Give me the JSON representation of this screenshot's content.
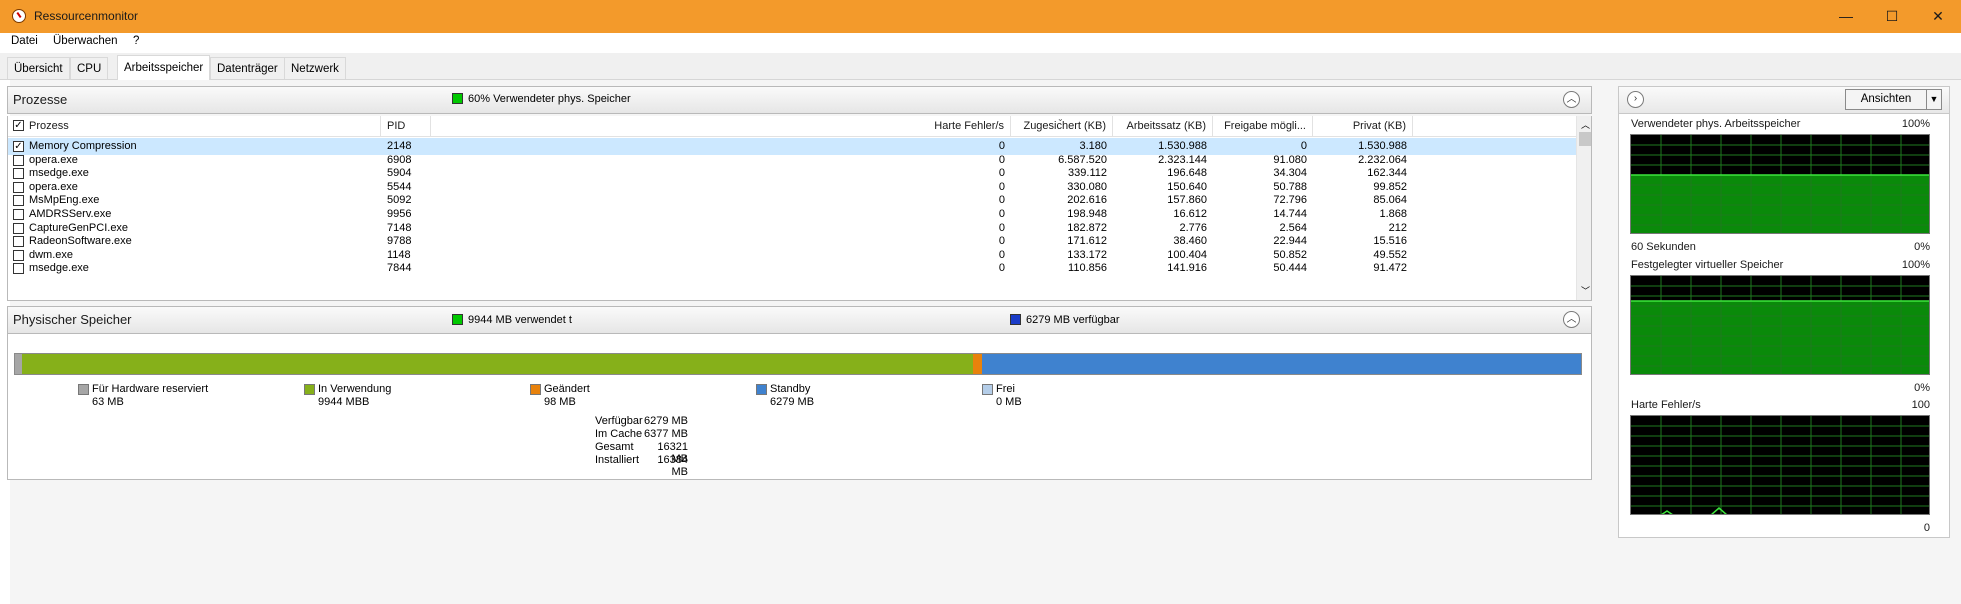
{
  "window": {
    "title": "Ressourcenmonitor",
    "controls": {
      "minimize": "—",
      "maximize": "☐",
      "close": "✕"
    }
  },
  "menu": [
    "Datei",
    "Überwachen",
    "?"
  ],
  "tabs": [
    {
      "label": "Übersicht",
      "active": false
    },
    {
      "label": "CPU",
      "active": false
    },
    {
      "label": "Arbeitsspeicher",
      "active": true
    },
    {
      "label": "Datenträger",
      "active": false
    },
    {
      "label": "Netzwerk",
      "active": false
    }
  ],
  "processes": {
    "title": "Prozesse",
    "summary": "60% Verwendeter phys. Speicher",
    "summary_color": "#00c800",
    "columns": [
      "Prozess",
      "PID",
      "Harte Fehler/s",
      "Zugesichert (KB)",
      "Arbeitssatz (KB)",
      "Freigabe mögli...",
      "Privat (KB)"
    ],
    "rows": [
      {
        "name": "Memory Compression",
        "pid": "2148",
        "faults": "0",
        "commit": "3.180",
        "working": "1.530.988",
        "shareable": "0",
        "private": "1.530.988",
        "checked": true,
        "selected": true
      },
      {
        "name": "opera.exe",
        "pid": "6908",
        "faults": "0",
        "commit": "6.587.520",
        "working": "2.323.144",
        "shareable": "91.080",
        "private": "2.232.064",
        "checked": false,
        "selected": false
      },
      {
        "name": "msedge.exe",
        "pid": "5904",
        "faults": "0",
        "commit": "339.112",
        "working": "196.648",
        "shareable": "34.304",
        "private": "162.344",
        "checked": false,
        "selected": false
      },
      {
        "name": "opera.exe",
        "pid": "5544",
        "faults": "0",
        "commit": "330.080",
        "working": "150.640",
        "shareable": "50.788",
        "private": "99.852",
        "checked": false,
        "selected": false
      },
      {
        "name": "MsMpEng.exe",
        "pid": "5092",
        "faults": "0",
        "commit": "202.616",
        "working": "157.860",
        "shareable": "72.796",
        "private": "85.064",
        "checked": false,
        "selected": false
      },
      {
        "name": "AMDRSServ.exe",
        "pid": "9956",
        "faults": "0",
        "commit": "198.948",
        "working": "16.612",
        "shareable": "14.744",
        "private": "1.868",
        "checked": false,
        "selected": false
      },
      {
        "name": "CaptureGenPCI.exe",
        "pid": "7148",
        "faults": "0",
        "commit": "182.872",
        "working": "2.776",
        "shareable": "2.564",
        "private": "212",
        "checked": false,
        "selected": false
      },
      {
        "name": "RadeonSoftware.exe",
        "pid": "9788",
        "faults": "0",
        "commit": "171.612",
        "working": "38.460",
        "shareable": "22.944",
        "private": "15.516",
        "checked": false,
        "selected": false
      },
      {
        "name": "dwm.exe",
        "pid": "1148",
        "faults": "0",
        "commit": "133.172",
        "working": "100.404",
        "shareable": "50.852",
        "private": "49.552",
        "checked": false,
        "selected": false
      },
      {
        "name": "msedge.exe",
        "pid": "7844",
        "faults": "0",
        "commit": "110.856",
        "working": "141.916",
        "shareable": "50.444",
        "private": "91.472",
        "checked": false,
        "selected": false
      }
    ]
  },
  "physical": {
    "title": "Physischer Speicher",
    "used_summary": "9944 MB verwendet t",
    "avail_summary": "6279 MB verfügbar",
    "used_color": "#00c800",
    "avail_color": "#1a3cc8",
    "bar": [
      {
        "key": "hardware",
        "mb": 63,
        "color": "#a6a6a6"
      },
      {
        "key": "inuse",
        "mb": 9944,
        "color": "#86b01a"
      },
      {
        "key": "modified",
        "mb": 98,
        "color": "#e8820c"
      },
      {
        "key": "standby",
        "mb": 6279,
        "color": "#3f82cf"
      },
      {
        "key": "free",
        "mb": 0,
        "color": "#b4cde8"
      }
    ],
    "legend": [
      {
        "label": "Für Hardware reserviert",
        "value": "63 MB",
        "color": "#a6a6a6"
      },
      {
        "label": "In Verwendung",
        "value": "9944 MBB",
        "color": "#86b01a"
      },
      {
        "label": "Geändert",
        "value": "98 MB",
        "color": "#e8820c"
      },
      {
        "label": "Standby",
        "value": "6279 MB",
        "color": "#3f82cf"
      },
      {
        "label": "Frei",
        "value": "0 MB",
        "color": "#b4cde8"
      }
    ],
    "stats": [
      {
        "label": "Verfügbar",
        "value": "6279 MB"
      },
      {
        "label": "Im Cache",
        "value": "6377 MB"
      },
      {
        "label": "Gesamt",
        "value": "16321 MB"
      },
      {
        "label": "Installiert",
        "value": "16384 MB"
      }
    ]
  },
  "graphs": {
    "views_label": "Ansichten",
    "items": [
      {
        "title": "Verwendeter phys. Arbeitsspeicher",
        "max": "100%",
        "footer_left": "60 Sekunden",
        "footer_right": "0%",
        "level": 0.6
      },
      {
        "title": "Festgelegter virtueller Speicher",
        "max": "100%",
        "footer_left": "",
        "footer_right": "0%",
        "level": 0.75
      },
      {
        "title": "Harte Fehler/s",
        "max": "100",
        "footer_left": "",
        "footer_right": "0",
        "level": 0.0
      }
    ]
  }
}
